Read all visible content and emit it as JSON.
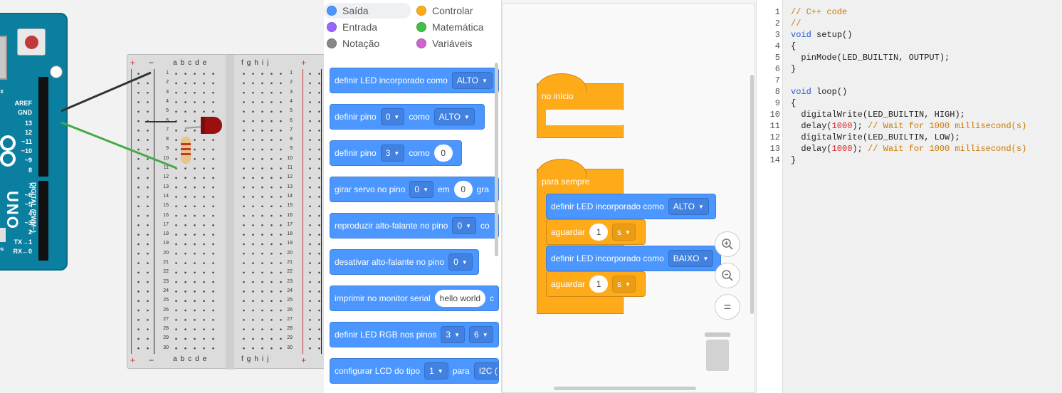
{
  "circuit": {
    "pin_labels": [
      "AREF",
      "GND",
      "13",
      "12",
      "~11",
      "~10",
      "~9",
      "8",
      "7",
      "~6",
      "~5",
      "4",
      "~3",
      "2",
      "TX→1",
      "RX←0"
    ],
    "board_name": "UNO",
    "board_subtitle": "DIGITAL (PWM~)",
    "tx_label": "TX",
    "on_label": "ON",
    "breadboard": {
      "col_header_left": "abcde",
      "col_header_right": "fghij",
      "rail_plus": "+",
      "rail_minus": "−",
      "row_numbers": [
        "1",
        "2",
        "3",
        "4",
        "5",
        "6",
        "7",
        "8",
        "9",
        "10",
        "11",
        "12",
        "13",
        "14",
        "15",
        "16",
        "17",
        "18",
        "19",
        "20",
        "21",
        "22",
        "23",
        "24",
        "25",
        "26",
        "27",
        "28",
        "29",
        "30"
      ]
    },
    "colors": {
      "board": "#0a7fa0",
      "wire_black": "#333333",
      "wire_green": "#44aa44",
      "led": "#9a1010"
    }
  },
  "palette": {
    "categories": [
      {
        "label": "Saída",
        "color": "#4c97ff",
        "selected": true
      },
      {
        "label": "Controlar",
        "color": "#ffab19",
        "selected": false
      },
      {
        "label": "Entrada",
        "color": "#9966ff",
        "selected": false
      },
      {
        "label": "Matemática",
        "color": "#40bf4a",
        "selected": false
      },
      {
        "label": "Notação",
        "color": "#888888",
        "selected": false
      },
      {
        "label": "Variáveis",
        "color": "#cf63cf",
        "selected": false
      }
    ],
    "blocks": {
      "b1": {
        "text": "definir LED incorporado como",
        "dd": "ALTO"
      },
      "b2": {
        "text": "definir pino",
        "pin": "0",
        "como": "como",
        "dd": "ALTO"
      },
      "b3": {
        "text": "definir pino",
        "pin": "3",
        "como": "como",
        "val": "0"
      },
      "b4": {
        "text": "girar servo no pino",
        "pin": "0",
        "em": "em",
        "val": "0",
        "tail": "gra"
      },
      "b5": {
        "text": "reproduzir alto-falante no pino",
        "pin": "0",
        "tail": "co"
      },
      "b6": {
        "text": "desativar alto-falante no pino",
        "pin": "0"
      },
      "b7": {
        "text": "imprimir no monitor serial",
        "val": "hello world",
        "tail": "c"
      },
      "b8": {
        "text": "definir LED RGB nos pinos",
        "p1": "3",
        "p2": "6"
      },
      "b9": {
        "text": "configurar LCD do tipo",
        "p1": "1",
        "para": "para",
        "tail": "I2C ("
      }
    }
  },
  "workspace": {
    "hat1": "no início",
    "hat2": "para sempre",
    "s1": {
      "text": "definir LED incorporado como",
      "dd": "ALTO"
    },
    "s2": {
      "text": "aguardar",
      "val": "1",
      "unit": "s"
    },
    "s3": {
      "text": "definir LED incorporado como",
      "dd": "BAIXO"
    },
    "s4": {
      "text": "aguardar",
      "val": "1",
      "unit": "s"
    },
    "zoom": {
      "in": "zoom-in",
      "out": "zoom-out",
      "reset": "="
    }
  },
  "code": {
    "lines": [
      {
        "n": "1",
        "t": "// C++ code"
      },
      {
        "n": "2",
        "t": "//"
      },
      {
        "n": "3",
        "t": "void setup()"
      },
      {
        "n": "4",
        "t": "{"
      },
      {
        "n": "5",
        "t": "  pinMode(LED_BUILTIN, OUTPUT);"
      },
      {
        "n": "6",
        "t": "}"
      },
      {
        "n": "7",
        "t": ""
      },
      {
        "n": "8",
        "t": "void loop()"
      },
      {
        "n": "9",
        "t": "{"
      },
      {
        "n": "10",
        "t": "  digitalWrite(LED_BUILTIN, HIGH);"
      },
      {
        "n": "11",
        "t": "  delay(1000); // Wait for 1000 millisecond(s)"
      },
      {
        "n": "12",
        "t": "  digitalWrite(LED_BUILTIN, LOW);"
      },
      {
        "n": "13",
        "t": "  delay(1000); // Wait for 1000 millisecond(s)"
      },
      {
        "n": "14",
        "t": "}"
      }
    ]
  }
}
